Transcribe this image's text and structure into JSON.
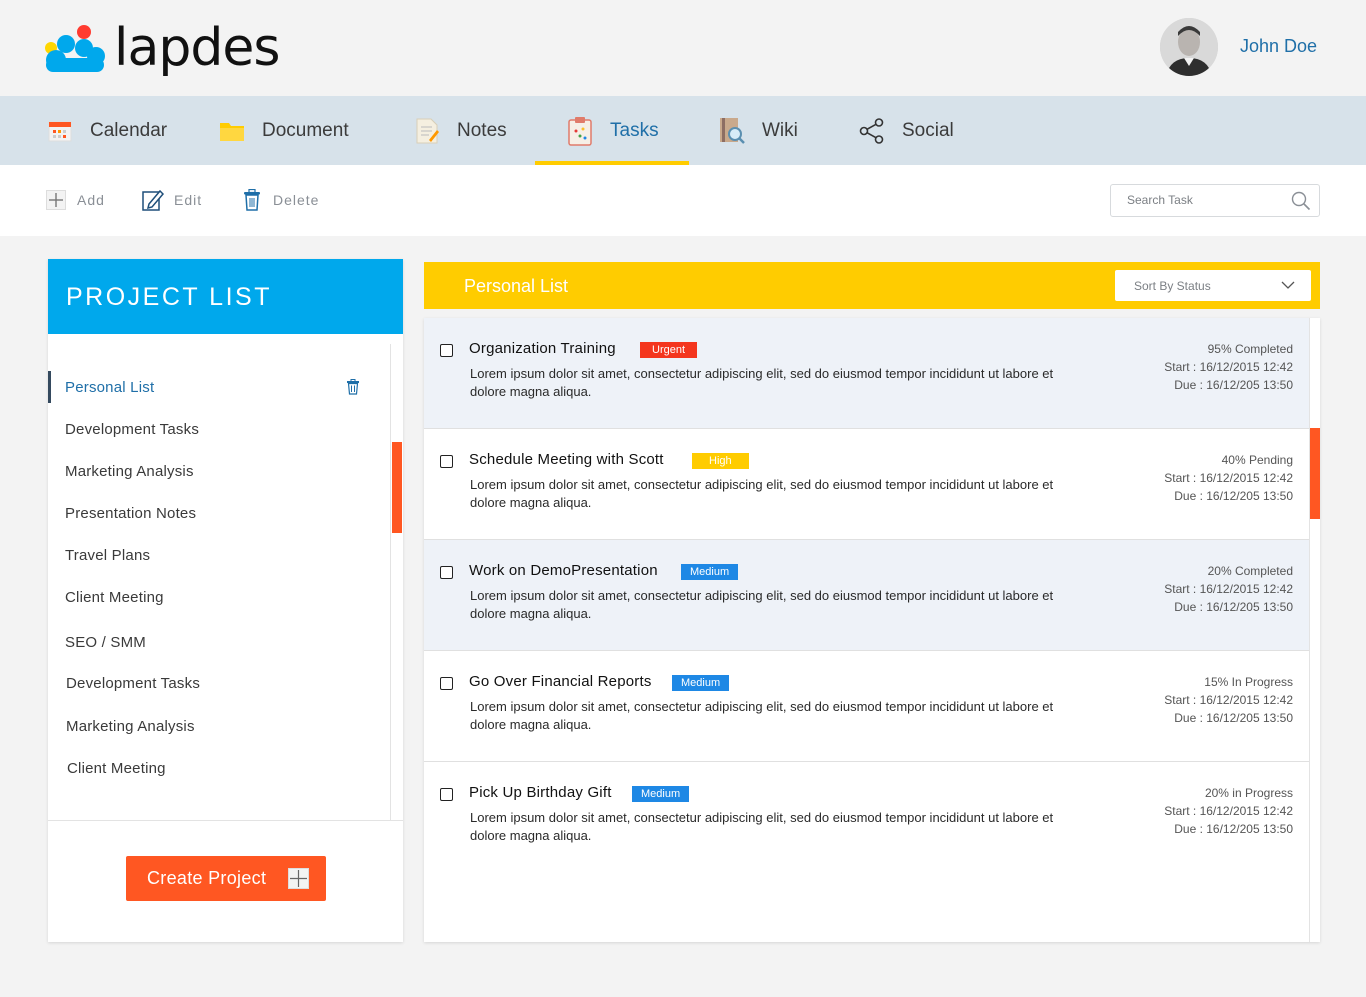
{
  "app": {
    "logo_text": "lapdes",
    "user_name": "John Doe"
  },
  "nav": {
    "items": [
      {
        "label": "Calendar",
        "icon": "calendar-icon"
      },
      {
        "label": "Document",
        "icon": "folder-icon"
      },
      {
        "label": "Notes",
        "icon": "notes-icon"
      },
      {
        "label": "Tasks",
        "icon": "clipboard-icon",
        "active": true
      },
      {
        "label": "Wiki",
        "icon": "book-search-icon"
      },
      {
        "label": "Social",
        "icon": "share-icon"
      }
    ]
  },
  "toolbar": {
    "add_label": "Add",
    "edit_label": "Edit",
    "delete_label": "Delete",
    "search_placeholder": "Search Task"
  },
  "projects": {
    "title": "PROJECT LIST",
    "items": [
      "Personal List",
      "Development Tasks",
      "Marketing Analysis",
      "Presentation Notes",
      "Travel Plans",
      "Client Meeting",
      "SEO / SMM",
      "Development Tasks",
      "Marketing Analysis",
      "Client Meeting"
    ],
    "active_index": 0,
    "create_label": "Create Project"
  },
  "tasks": {
    "list_title": "Personal List",
    "sort_label": "Sort By Status",
    "items": [
      {
        "title": "Organization Training",
        "priority": "Urgent",
        "priority_color": "#f4361e",
        "description": "Lorem ipsum dolor sit amet, consectetur adipiscing elit, sed do eiusmod tempor incididunt ut labore et dolore magna aliqua.",
        "status": "95% Completed",
        "start": "Start : 16/12/2015 12:42",
        "due": "Due : 16/12/205 13:50"
      },
      {
        "title": "Schedule Meeting with Scott",
        "priority": "High",
        "priority_color": "#ffcc00",
        "description": "Lorem ipsum dolor sit amet, consectetur adipiscing elit, sed do eiusmod tempor incididunt ut labore et dolore magna aliqua.",
        "status": "40%  Pending",
        "start": "Start : 16/12/2015 12:42",
        "due": "Due : 16/12/205 13:50"
      },
      {
        "title": "Work on DemoPresentation",
        "priority": "Medium",
        "priority_color": "#1e88e5",
        "description": "Lorem ipsum dolor sit amet, consectetur adipiscing elit, sed do eiusmod tempor incididunt ut labore et dolore magna aliqua.",
        "status": "20% Completed",
        "start": "Start : 16/12/2015 12:42",
        "due": "Due : 16/12/205 13:50"
      },
      {
        "title": "Go Over Financial Reports",
        "priority": "Medium",
        "priority_color": "#1e88e5",
        "description": "Lorem ipsum dolor sit amet, consectetur adipiscing elit, sed do eiusmod tempor incididunt ut labore et dolore magna aliqua.",
        "status": "15% In Progress",
        "start": "Start : 16/12/2015 12:42",
        "due": "Due : 16/12/205 13:50"
      },
      {
        "title": "Pick Up Birthday Gift",
        "priority": "Medium",
        "priority_color": "#1e88e5",
        "description": "Lorem ipsum dolor sit amet, consectetur adipiscing elit, sed do eiusmod tempor incididunt ut labore et dolore magna aliqua.",
        "status": "20% in Progress",
        "start": "Start : 16/12/2015 12:42",
        "due": "Due : 16/12/205 13:50"
      }
    ]
  },
  "colors": {
    "accent_blue": "#00a8ec",
    "accent_yellow": "#ffcc00",
    "accent_orange": "#ff5722",
    "nav_bg": "#d7e2ea",
    "link_blue": "#1f6fa8"
  }
}
